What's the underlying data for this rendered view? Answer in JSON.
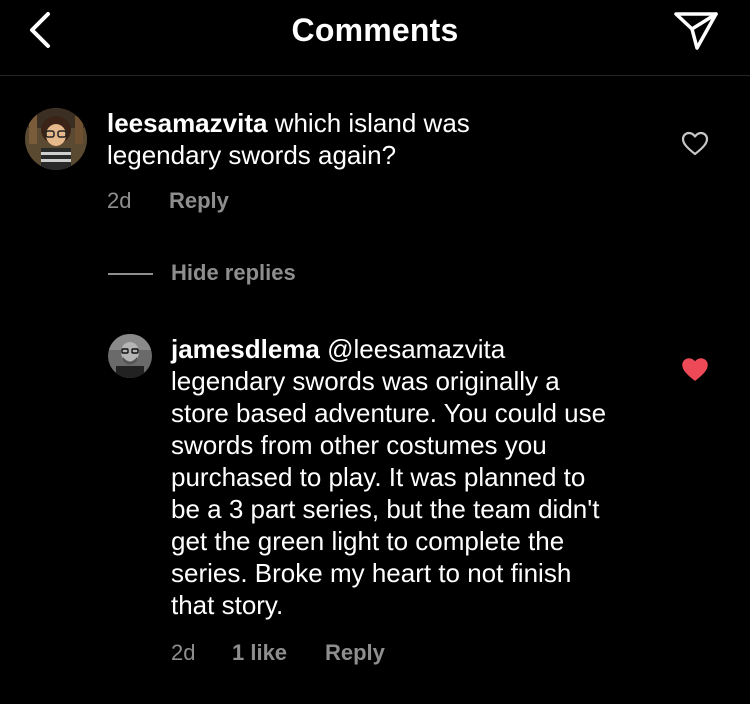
{
  "header": {
    "title": "Comments",
    "back_icon": "chevron-left-icon",
    "send_icon": "paper-plane-icon"
  },
  "comments": [
    {
      "username": "leesamazvita",
      "text": "which island was legendary swords again?",
      "time": "2d",
      "reply_label": "Reply",
      "liked": false
    }
  ],
  "hide_replies_label": "Hide replies",
  "replies": [
    {
      "username": "jamesdlema",
      "mention": "@leesamazvita",
      "text": "legendary swords was originally a store based adventure. You could use swords from other costumes you purchased to play. It was planned to be a 3 part series, but the team didn't get the green light to complete the series. Broke my heart to not finish that story.",
      "time": "2d",
      "likes_label": "1 like",
      "reply_label": "Reply",
      "liked": true
    }
  ],
  "colors": {
    "background": "#000000",
    "text": "#ffffff",
    "secondary_text": "#8e8e8e",
    "like_red": "#ed4956",
    "divider": "#262626"
  }
}
